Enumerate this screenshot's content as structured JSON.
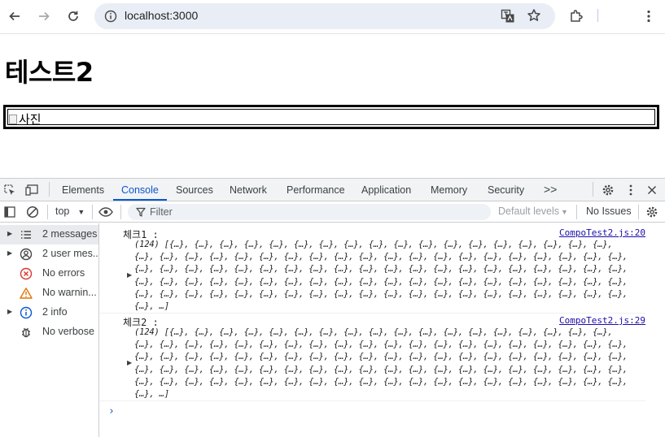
{
  "browser": {
    "url": "localhost:3000"
  },
  "page": {
    "title": "테스트2",
    "image_alt": "사진"
  },
  "devtools": {
    "tabs": [
      "Elements",
      "Console",
      "Sources",
      "Network",
      "Performance",
      "Application",
      "Memory",
      "Security"
    ],
    "more_tabs": ">>",
    "context": "top",
    "filter_placeholder": "Filter",
    "levels": "Default levels",
    "issues": "No Issues",
    "sidebar": [
      {
        "label": "2 messages",
        "icon": "list-icon"
      },
      {
        "label": "2 user mes...",
        "icon": "user-icon"
      },
      {
        "label": "No errors",
        "icon": "error-icon"
      },
      {
        "label": "No warnin...",
        "icon": "warning-icon"
      },
      {
        "label": "2 info",
        "icon": "info-icon"
      },
      {
        "label": "No verbose",
        "icon": "bug-icon"
      }
    ],
    "messages": [
      {
        "label": "체크1 :",
        "source": "CompoTest2.js:20",
        "array_text": "(124) [{…}, {…}, {…}, {…}, {…}, {…}, {…}, {…}, {…}, {…}, {…}, {…}, {…}, {…}, {…}, {…}, {…}, {…}, {…}, {…}, {…}, {…}, {…}, {…}, {…}, {…}, {…}, {…}, {…}, {…}, {…}, {…}, {…}, {…}, {…}, {…}, {…}, {…}, {…}, {…}, {…}, {…}, {…}, {…}, {…}, {…}, {…}, {…}, {…}, {…}, {…}, {…}, {…}, {…}, {…}, {…}, {…}, {…}, {…}, {…}, {…}, {…}, {…}, {…}, {…}, {…}, {…}, {…}, {…}, {…}, {…}, {…}, {…}, {…}, {…}, {…}, {…}, {…}, {…}, {…}, {…}, {…}, {…}, {…}, {…}, {…}, {…}, {…}, {…}, {…}, {…}, {…}, {…}, {…}, {…}, {…}, {…}, {…}, {…}, …]"
      },
      {
        "label": "체크2 :",
        "source": "CompoTest2.js:29",
        "array_text": "(124) [{…}, {…}, {…}, {…}, {…}, {…}, {…}, {…}, {…}, {…}, {…}, {…}, {…}, {…}, {…}, {…}, {…}, {…}, {…}, {…}, {…}, {…}, {…}, {…}, {…}, {…}, {…}, {…}, {…}, {…}, {…}, {…}, {…}, {…}, {…}, {…}, {…}, {…}, {…}, {…}, {…}, {…}, {…}, {…}, {…}, {…}, {…}, {…}, {…}, {…}, {…}, {…}, {…}, {…}, {…}, {…}, {…}, {…}, {…}, {…}, {…}, {…}, {…}, {…}, {…}, {…}, {…}, {…}, {…}, {…}, {…}, {…}, {…}, {…}, {…}, {…}, {…}, {…}, {…}, {…}, {…}, {…}, {…}, {…}, {…}, {…}, {…}, {…}, {…}, {…}, {…}, {…}, {…}, {…}, {…}, {…}, {…}, {…}, {…}, …]"
      }
    ],
    "prompt": "›"
  }
}
